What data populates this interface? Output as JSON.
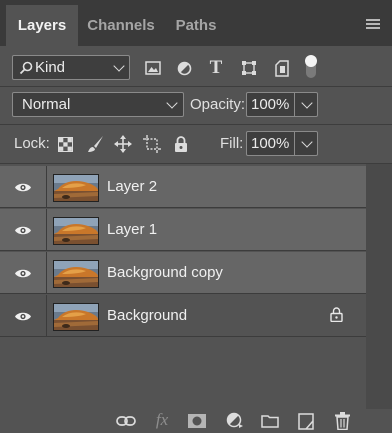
{
  "tabs": [
    {
      "label": "Layers"
    },
    {
      "label": "Channels"
    },
    {
      "label": "Paths"
    }
  ],
  "filter": {
    "kind_label": "Kind"
  },
  "blend": {
    "mode": "Normal",
    "opacity_label": "Opacity:",
    "opacity_value": "100%"
  },
  "lock": {
    "label": "Lock:",
    "fill_label": "Fill:",
    "fill_value": "100%"
  },
  "layers": [
    {
      "name": "Layer 2",
      "selected": true,
      "locked": false
    },
    {
      "name": "Layer 1",
      "selected": true,
      "locked": false
    },
    {
      "name": "Background copy",
      "selected": true,
      "locked": false
    },
    {
      "name": "Background",
      "selected": false,
      "locked": true
    }
  ],
  "footer": {
    "fx_label": "fx"
  },
  "colors": {
    "panel_bg": "#535353",
    "tabbar_bg": "#3a3a3a",
    "selected_row_bg": "#666666"
  }
}
